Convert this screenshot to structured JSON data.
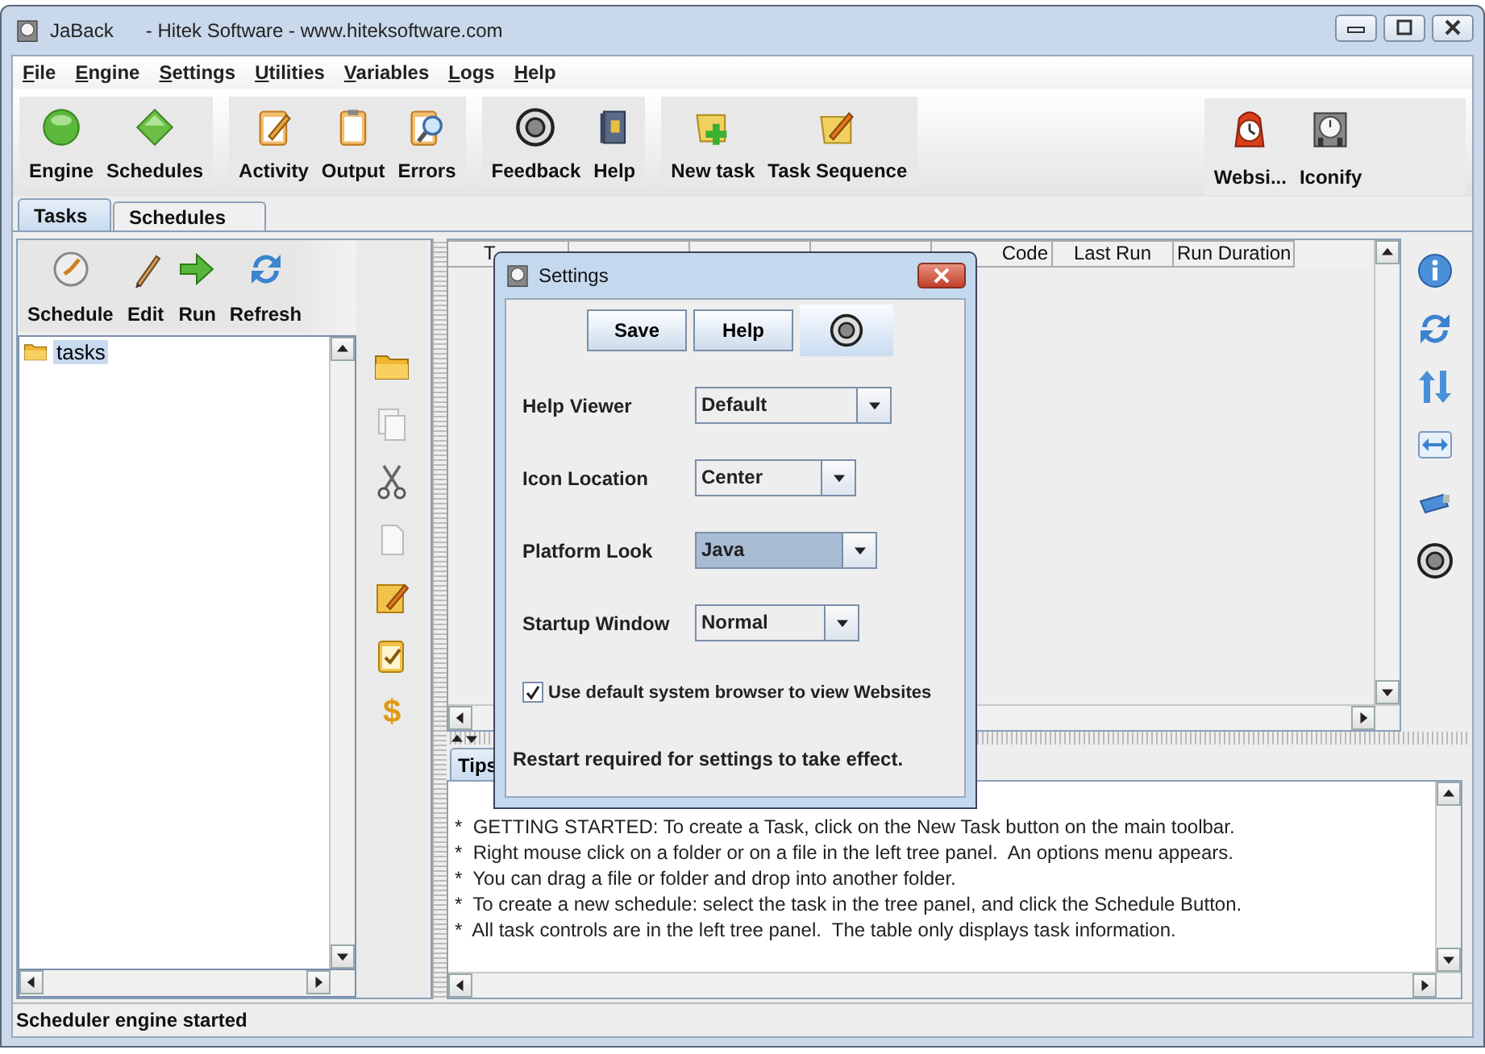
{
  "window": {
    "app_name": "JaBack",
    "title": "- Hitek Software - www.hiteksoftware.com"
  },
  "menu": [
    "File",
    "Engine",
    "Settings",
    "Utilities",
    "Variables",
    "Logs",
    "Help"
  ],
  "toolbar_groups": [
    [
      "Engine",
      "Schedules"
    ],
    [
      "Activity",
      "Output",
      "Errors"
    ],
    [
      "Feedback",
      "Help"
    ],
    [
      "New task",
      "Task Sequence"
    ],
    [
      "Websi...",
      "Iconify"
    ]
  ],
  "tabs": [
    {
      "label": "Tasks",
      "selected": true
    },
    {
      "label": "Schedules",
      "selected": false
    }
  ],
  "task_toolbar": [
    "Schedule",
    "Edit",
    "Run",
    "Refresh"
  ],
  "tree": [
    {
      "label": "tasks",
      "selected": true
    }
  ],
  "tool_column": {
    "last_glyph": "$"
  },
  "table": {
    "columns": [
      {
        "label": "T"
      },
      {},
      {},
      {},
      {
        "label": "Code"
      },
      {
        "label": "Last Run"
      },
      {
        "label": "Run Duration"
      }
    ]
  },
  "tips": {
    "tab": "Tips",
    "lines": [
      "*  GETTING STARTED: To create a Task, click on the New Task button on the main toolbar.",
      "*  Right mouse click on a folder or on a file in the left tree panel.  An options menu appears.",
      "*  You can drag a file or folder and drop into another folder.",
      "*  To create a new schedule: select the task in the tree panel, and click the Schedule Button.",
      "*  All task controls are in the left tree panel.  The table only displays task information."
    ]
  },
  "dialog": {
    "title": "Settings",
    "buttons": [
      "Save",
      "Help"
    ],
    "fields": [
      {
        "label": "Help Viewer",
        "value": "Default",
        "selected": false
      },
      {
        "label": "Icon Location",
        "value": "Center",
        "selected": false
      },
      {
        "label": "Platform Look",
        "value": "Java",
        "selected": true
      },
      {
        "label": "Startup Window",
        "value": "Normal",
        "selected": false
      }
    ],
    "checkbox": {
      "label": "Use default system browser to view Websites",
      "checked": true
    },
    "note": "Restart required for settings to take effect."
  },
  "status_bar": "Scheduler engine started"
}
